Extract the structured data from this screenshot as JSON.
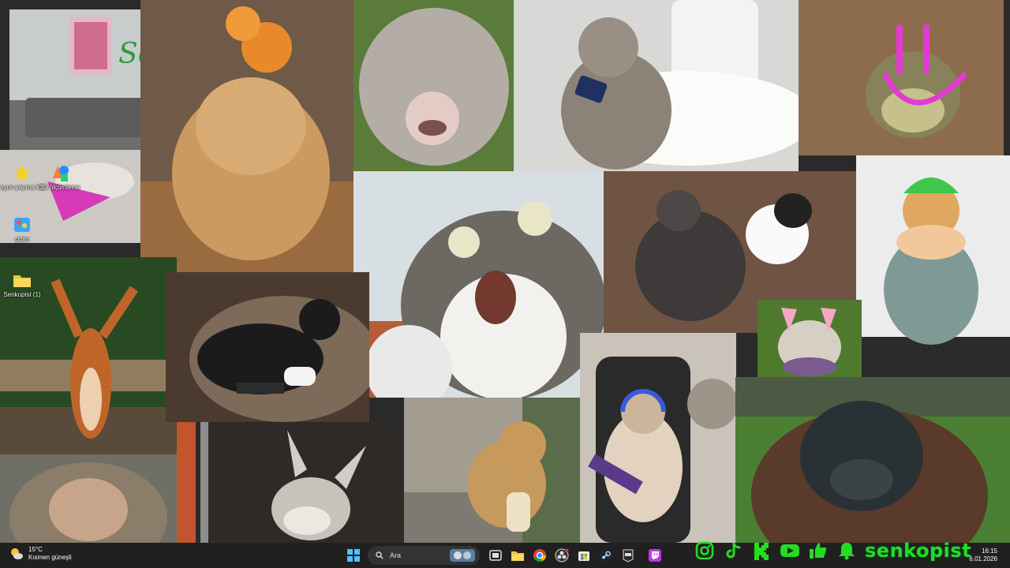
{
  "desktop": {
    "icons": [
      {
        "label": "oyun yapma kiti",
        "icon": "star-icon"
      },
      {
        "label": "3D ölçümleme",
        "icon": "3d-shapes-icon"
      },
      {
        "label": "çizim",
        "icon": "paint-icon"
      },
      {
        "label": "Senkopist (1)",
        "icon": "folder-icon"
      }
    ],
    "wallpaper_text": "Senko"
  },
  "taskbar": {
    "weather": {
      "temp": "15°C",
      "desc": "Kısmen güneşli",
      "icon": "partly-sunny-icon"
    },
    "search_placeholder": "Ara",
    "pinned": [
      {
        "name": "task-view-icon"
      },
      {
        "name": "file-explorer-icon"
      },
      {
        "name": "chrome-icon"
      },
      {
        "name": "obs-icon"
      },
      {
        "name": "microsoft-store-icon"
      },
      {
        "name": "steam-icon"
      },
      {
        "name": "epic-games-icon"
      },
      {
        "name": "twitch-icon"
      }
    ],
    "clock": {
      "time": "16:15",
      "date": "6.01.2026"
    }
  },
  "overlay": {
    "brand_name": "senkopist",
    "social_icons": [
      "instagram-icon",
      "tiktok-icon",
      "kick-icon",
      "youtube-icon",
      "like-icon",
      "notification-bell-icon"
    ],
    "brand_color": "#22dd22"
  },
  "colors": {
    "taskbar_bg": "#202020",
    "accent_green": "#22dd22",
    "folder_yellow": "#f3c33c"
  }
}
